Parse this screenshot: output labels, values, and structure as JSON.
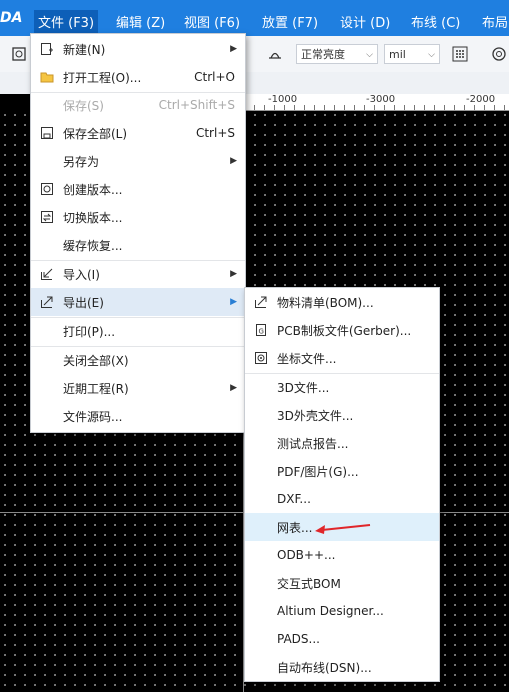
{
  "app": {
    "logo": "DA"
  },
  "menubar": {
    "items": [
      {
        "label": "文件 (F3)",
        "active": true
      },
      {
        "label": "编辑 (Z)"
      },
      {
        "label": "视图 (F6)"
      },
      {
        "label": "放置 (F7)"
      },
      {
        "label": "设计 (D)"
      },
      {
        "label": "布线 (C)"
      },
      {
        "label": "布局"
      }
    ]
  },
  "toolbar": {
    "brightness_select": "正常亮度",
    "unit_select": "mil"
  },
  "ruler": {
    "ticks": [
      "-1000",
      "-3000",
      "-2000"
    ]
  },
  "file_menu": {
    "items": [
      {
        "label": "新建(N)",
        "icon": "new-file-icon",
        "submenu": true
      },
      {
        "label": "打开工程(O)...",
        "shortcut": "Ctrl+O",
        "icon": "folder-icon"
      },
      {
        "label": "保存(S)",
        "shortcut": "Ctrl+Shift+S",
        "disabled": true
      },
      {
        "label": "保存全部(L)",
        "shortcut": "Ctrl+S",
        "icon": "save-icon"
      },
      {
        "label": "另存为",
        "submenu": true
      },
      {
        "label": "创建版本...",
        "icon": "create-version-icon"
      },
      {
        "label": "切换版本...",
        "icon": "switch-version-icon"
      },
      {
        "label": "缓存恢复..."
      },
      {
        "label": "导入(I)",
        "icon": "import-icon",
        "submenu": true
      },
      {
        "label": "导出(E)",
        "icon": "export-icon",
        "submenu": true,
        "hover": true
      },
      {
        "label": "打印(P)..."
      },
      {
        "label": "关闭全部(X)"
      },
      {
        "label": "近期工程(R)",
        "submenu": true
      },
      {
        "label": "文件源码..."
      }
    ]
  },
  "export_menu": {
    "items": [
      {
        "label": "物料清单(BOM)...",
        "icon": "export-bom-icon"
      },
      {
        "label": "PCB制板文件(Gerber)...",
        "icon": "gerber-file-icon"
      },
      {
        "label": "坐标文件...",
        "icon": "coordinate-file-icon"
      },
      {
        "label": "3D文件..."
      },
      {
        "label": "3D外壳文件..."
      },
      {
        "label": "测试点报告..."
      },
      {
        "label": "PDF/图片(G)..."
      },
      {
        "label": "DXF..."
      },
      {
        "label": "网表...",
        "hover": true
      },
      {
        "label": "ODB++..."
      },
      {
        "label": "交互式BOM"
      },
      {
        "label": "Altium Designer..."
      },
      {
        "label": "PADS..."
      },
      {
        "label": "自动布线(DSN)..."
      }
    ]
  },
  "colors": {
    "menubar": "#1f7fe0",
    "hover": "#dfeaf6",
    "annotation_arrow": "#e0262a"
  }
}
